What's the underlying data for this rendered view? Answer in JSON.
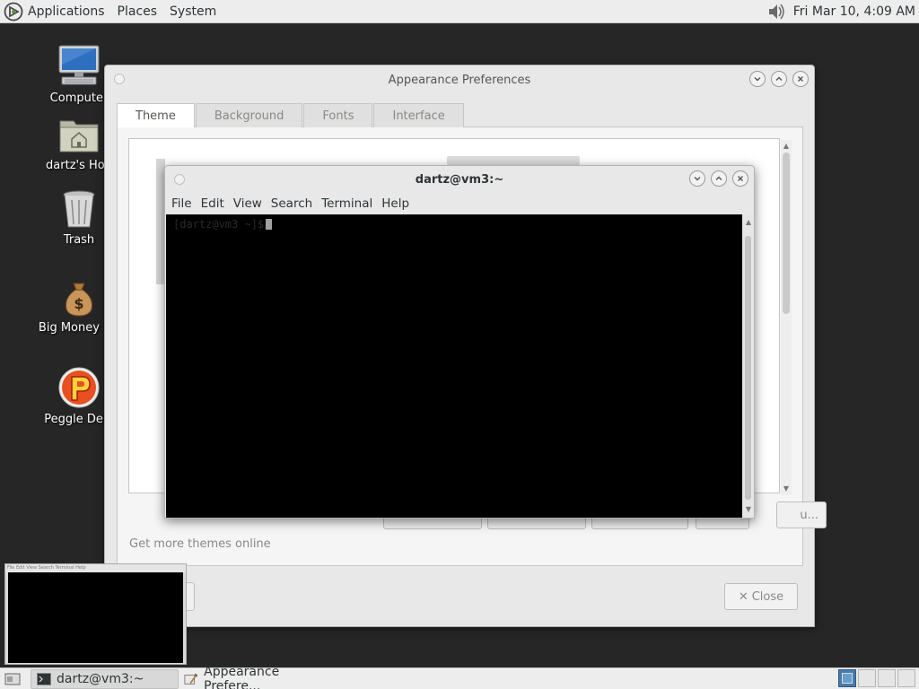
{
  "top_panel": {
    "menus": [
      "Applications",
      "Places",
      "System"
    ],
    "clock": "Fri Mar 10,  4:09 AM",
    "icons": {
      "apps": "distro-logo-icon",
      "volume": "volume-icon"
    }
  },
  "desktop": {
    "icons": [
      {
        "label": "Computer",
        "icon": "computer-icon"
      },
      {
        "label": "dartz's Hon",
        "icon": "home-folder-icon"
      },
      {
        "label": "Trash",
        "icon": "trash-icon"
      },
      {
        "label": "Big Money De",
        "icon": "money-bag-icon"
      },
      {
        "label": "Peggle Delu",
        "icon": "peggle-icon"
      }
    ]
  },
  "appearance": {
    "title": "Appearance Preferences",
    "tabs": [
      "Theme",
      "Background",
      "Fonts",
      "Interface"
    ],
    "active_tab": "Theme",
    "get_more_link": "Get more themes online",
    "customize_partial": "u...",
    "close_label": "Close"
  },
  "terminal": {
    "title": "dartz@vm3:~",
    "menus": [
      "File",
      "Edit",
      "View",
      "Search",
      "Terminal",
      "Help"
    ],
    "prompt": "[dartz@vm3 ~]$"
  },
  "preview": {
    "menubar": "File  Edit  View  Search  Terminal  Help"
  },
  "bottom_panel": {
    "tasks": [
      {
        "label": "dartz@vm3:~",
        "icon": "terminal-icon",
        "active": true
      },
      {
        "label": "Appearance Prefere...",
        "icon": "appearance-icon",
        "active": false
      }
    ],
    "show_desktop_icon": "show-desktop-icon",
    "workspaces": 4,
    "active_workspace": 1
  },
  "colors": {
    "desktop_bg": "#262626",
    "panel_bg": "#ededed",
    "terminal_bg": "#000000",
    "workspace_active": "#4a7aa8"
  }
}
